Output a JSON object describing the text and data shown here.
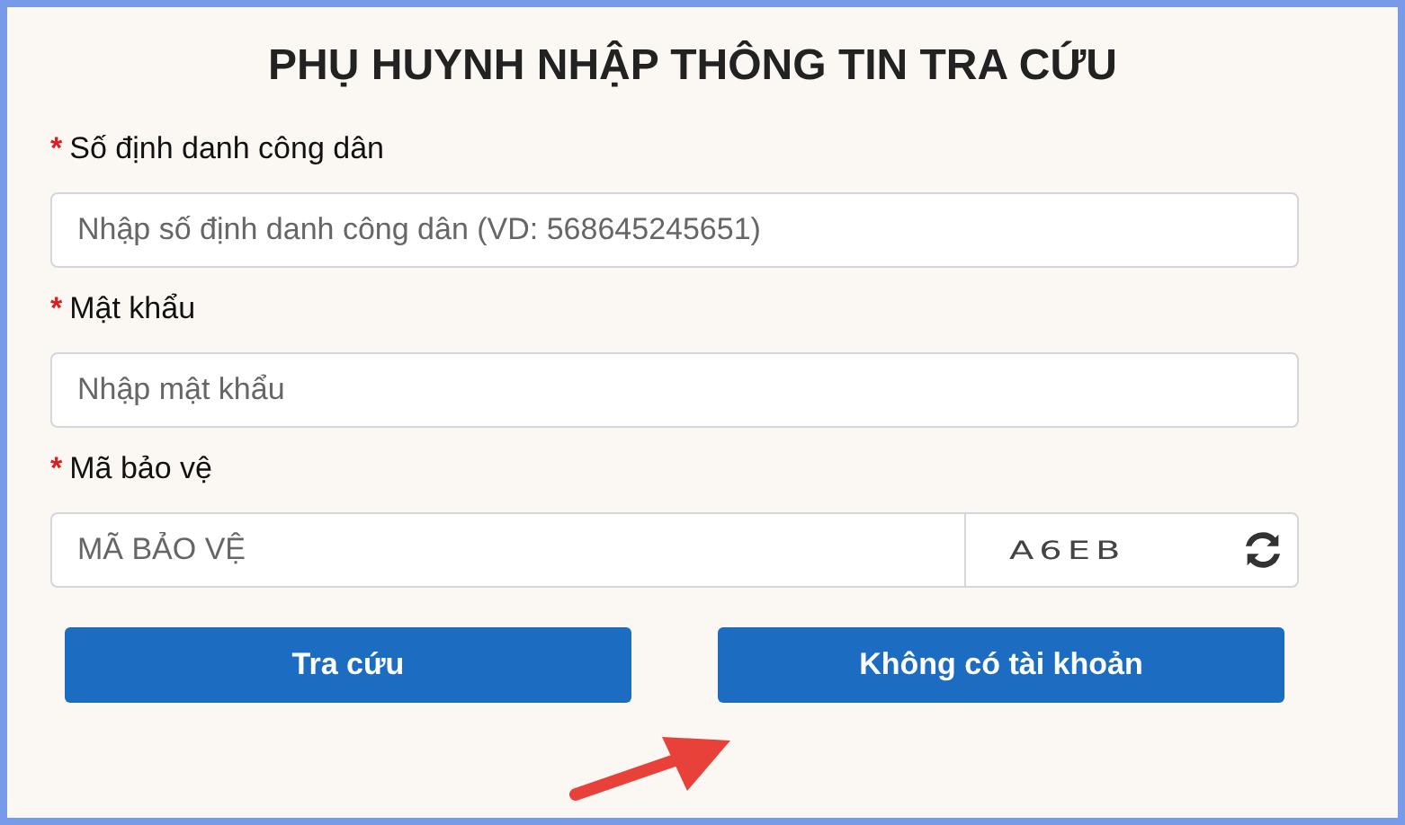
{
  "title": "PHỤ HUYNH NHẬP THÔNG TIN TRA CỨU",
  "fields": [
    {
      "kind": "text",
      "required_mark": "*",
      "label": "Số định danh công dân",
      "placeholder": "Nhập số định danh công dân (VD: 568645245651)"
    },
    {
      "kind": "text",
      "required_mark": "*",
      "label": "Mật khẩu",
      "placeholder": "Nhập mật khẩu"
    },
    {
      "kind": "captcha",
      "required_mark": "*",
      "label": "Mã bảo vệ",
      "placeholder": "MÃ BẢO VỆ",
      "captcha": "A6EB"
    }
  ],
  "buttons": [
    "Tra cứu",
    "Không có tài khoản"
  ]
}
